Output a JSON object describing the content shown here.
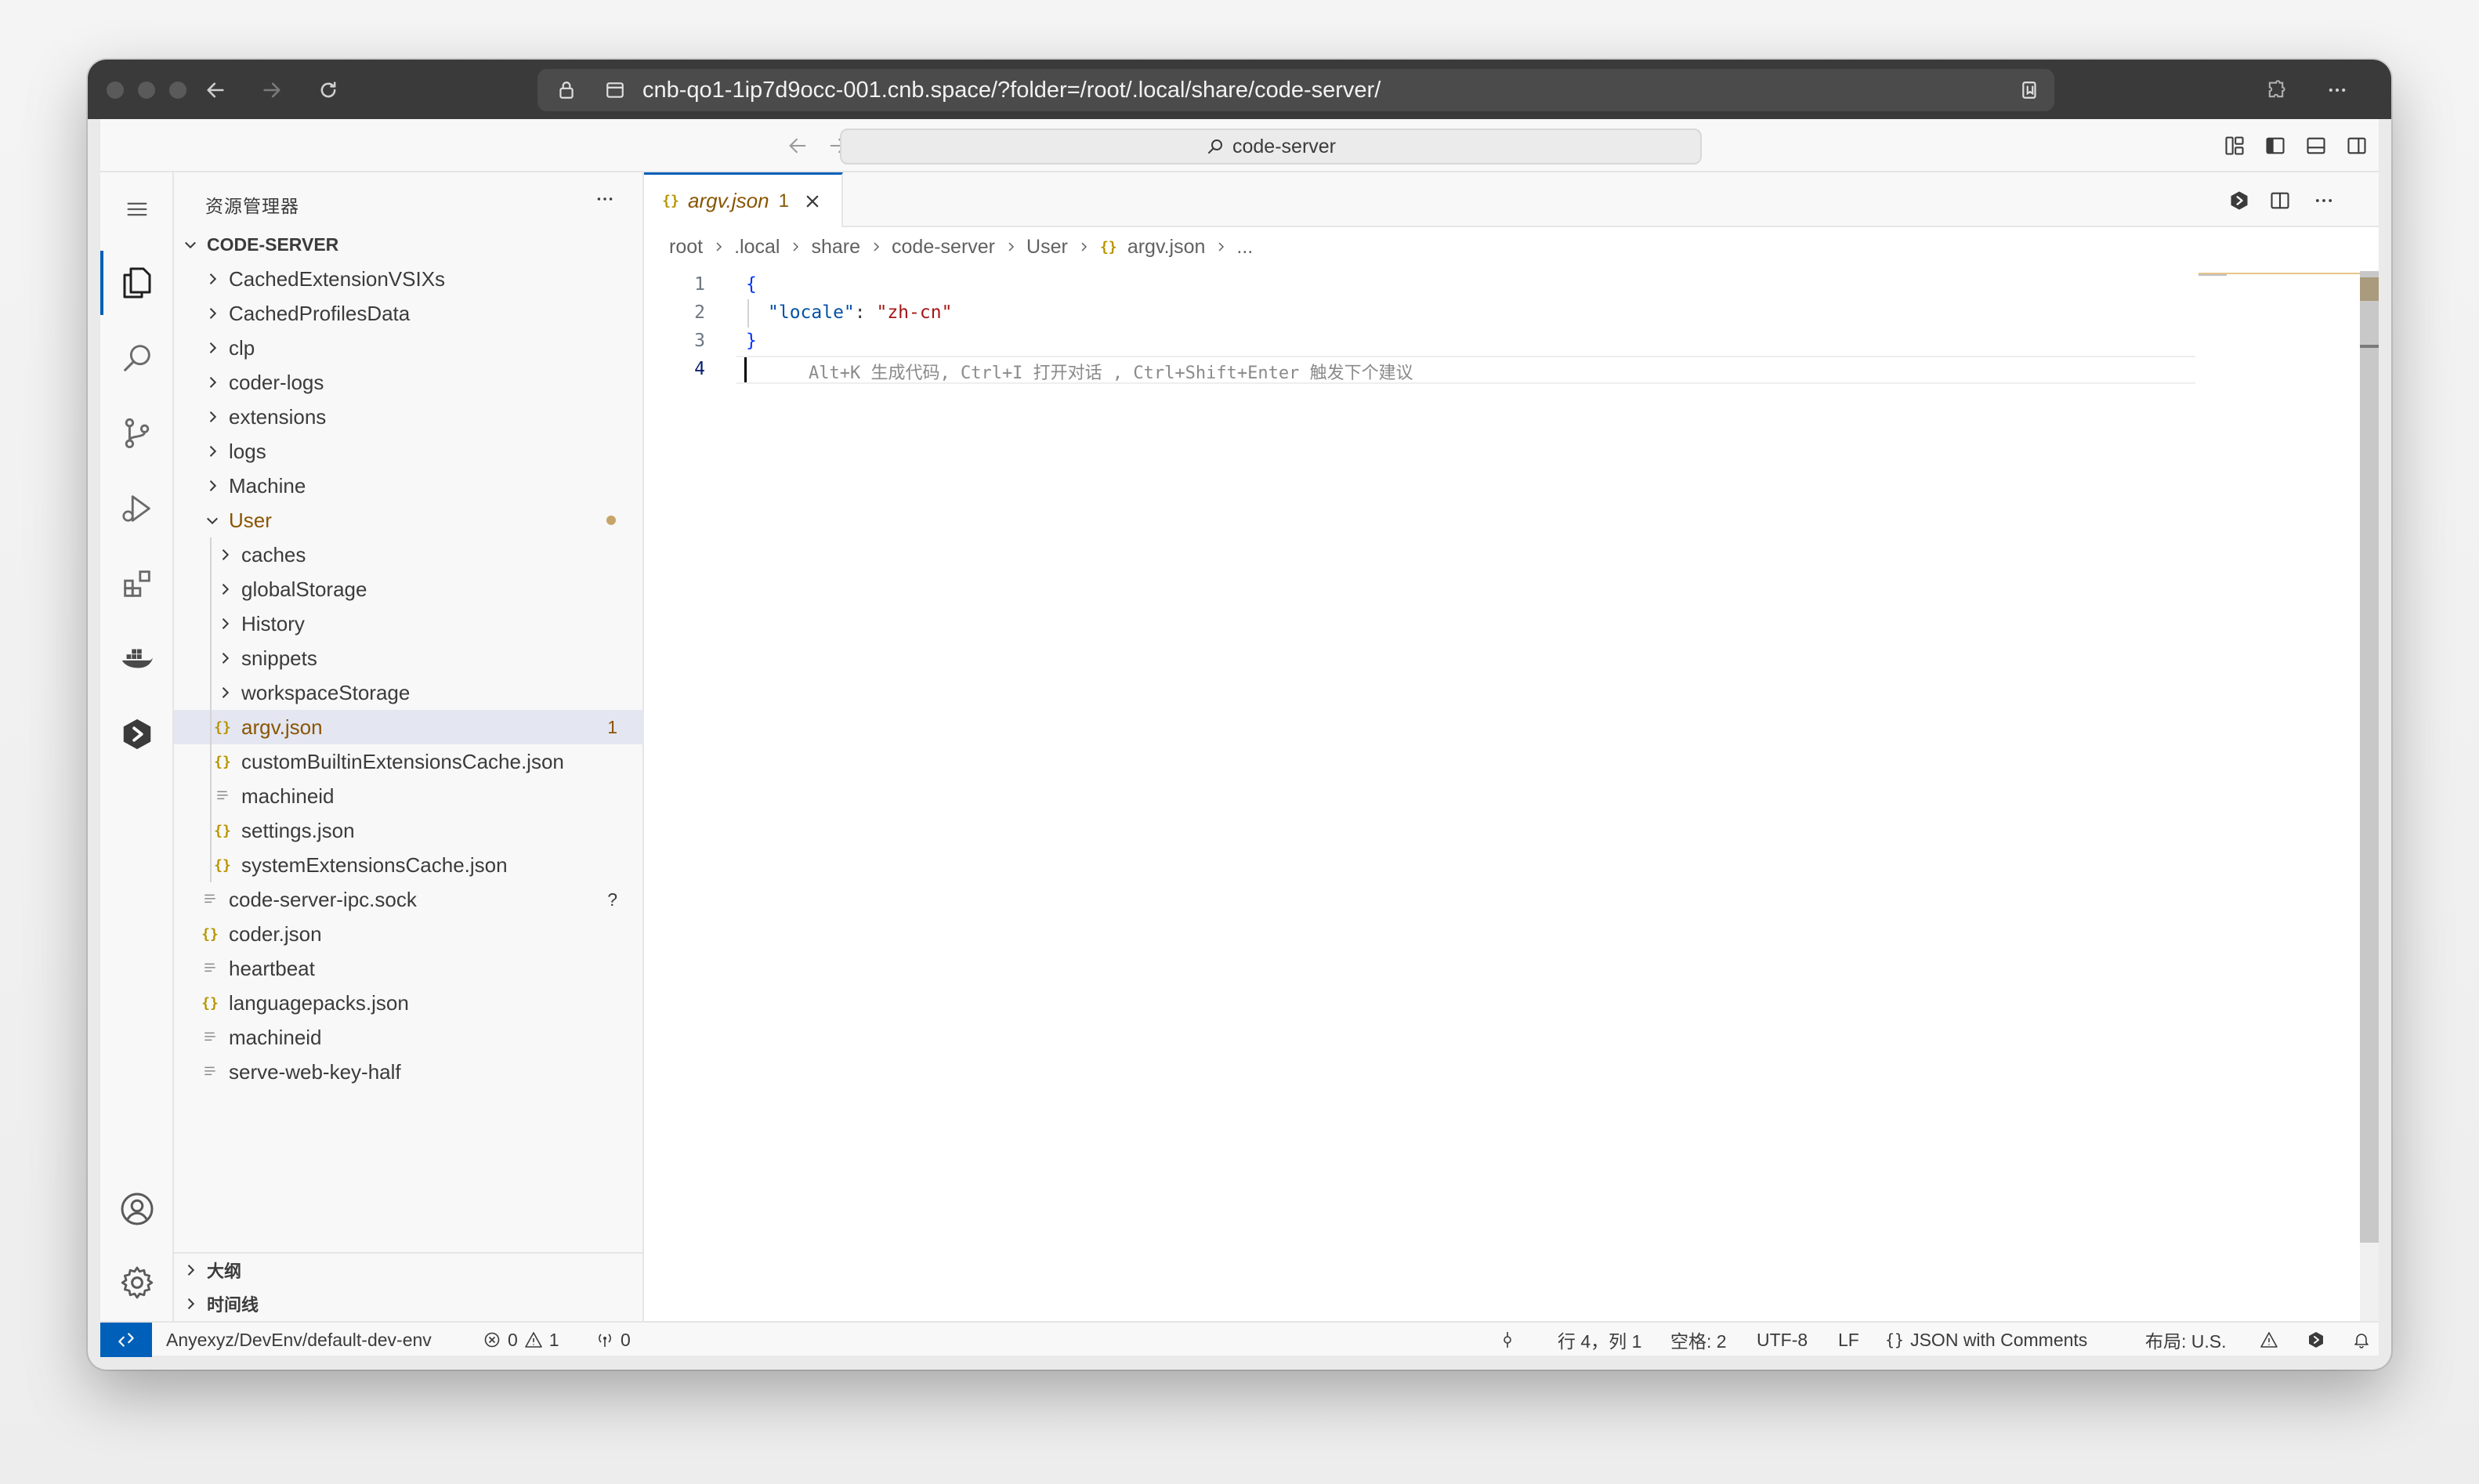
{
  "browser": {
    "url": "cnb-qo1-1ip7d9occ-001.cnb.space/?folder=/root/.local/share/code-server/"
  },
  "titlebar": {
    "search_label": "code-server"
  },
  "sidebar": {
    "title": "资源管理器",
    "root_label": "CODE-SERVER",
    "items": [
      {
        "label": "CachedExtensionVSIXs"
      },
      {
        "label": "CachedProfilesData"
      },
      {
        "label": "clp"
      },
      {
        "label": "coder-logs"
      },
      {
        "label": "extensions"
      },
      {
        "label": "logs"
      },
      {
        "label": "Machine"
      },
      {
        "label": "User"
      },
      {
        "label": "caches"
      },
      {
        "label": "globalStorage"
      },
      {
        "label": "History"
      },
      {
        "label": "snippets"
      },
      {
        "label": "workspaceStorage"
      },
      {
        "label": "argv.json",
        "badge": "1"
      },
      {
        "label": "customBuiltinExtensionsCache.json"
      },
      {
        "label": "machineid"
      },
      {
        "label": "settings.json"
      },
      {
        "label": "systemExtensionsCache.json"
      },
      {
        "label": "code-server-ipc.sock",
        "badge": "?"
      },
      {
        "label": "coder.json"
      },
      {
        "label": "heartbeat"
      },
      {
        "label": "languagepacks.json"
      },
      {
        "label": "machineid"
      },
      {
        "label": "serve-web-key-half"
      }
    ],
    "outline_label": "大纲",
    "timeline_label": "时间线"
  },
  "editor": {
    "tab": {
      "label": "argv.json",
      "problems": "1"
    },
    "breadcrumb": [
      "root",
      ".local",
      "share",
      "code-server",
      "User",
      "argv.json",
      "..."
    ],
    "lines": {
      "n1": "1",
      "n2": "2",
      "n3": "3",
      "n4": "4",
      "open_brace": "{",
      "key": "\"locale\"",
      "colon": ": ",
      "value": "\"zh-cn\"",
      "close_brace": "}",
      "hint": "Alt+K 生成代码, Ctrl+I 打开对话 , Ctrl+Shift+Enter 触发下个建议"
    }
  },
  "statusbar": {
    "workspace": "Anyexyz/DevEnv/default-dev-env",
    "errors": "0",
    "warnings": "1",
    "ports": "0",
    "position": "行 4，列 1",
    "spaces": "空格: 2",
    "encoding": "UTF-8",
    "eol": "LF",
    "language": "JSON with Comments",
    "layout": "布局: U.S."
  },
  "colors": {
    "accent": "#005fb8",
    "modified": "#895503",
    "json_icon": "#b89500"
  }
}
